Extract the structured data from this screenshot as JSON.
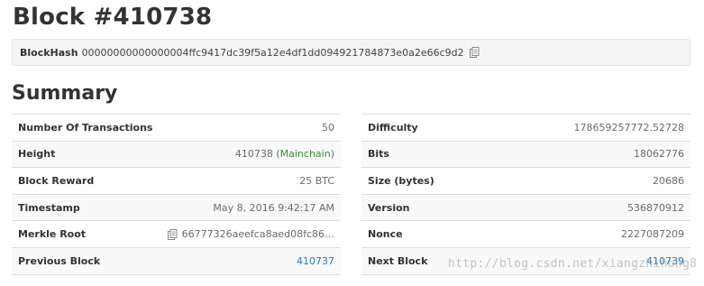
{
  "page": {
    "title": "Block #410738"
  },
  "hash": {
    "label": "BlockHash",
    "value": "00000000000000004ffc9417dc39f5a12e4df1dd094921784873e0a2e66c9d2",
    "copy_icon": "copy-icon"
  },
  "summary": {
    "title": "Summary",
    "left": {
      "transactions_label": "Number Of Transactions",
      "transactions_value": "50",
      "height_label": "Height",
      "height_value": "410738",
      "height_chain_prefix": " (",
      "height_chain": "Mainchain",
      "height_chain_suffix": ")",
      "reward_label": "Block Reward",
      "reward_value": "25 BTC",
      "timestamp_label": "Timestamp",
      "timestamp_value": "May 8, 2016 9:42:17 AM",
      "merkle_label": "Merkle Root",
      "merkle_value": "66777326aeefca8aed08fc86…",
      "previous_label": "Previous Block",
      "previous_value": "410737"
    },
    "right": {
      "difficulty_label": "Difficulty",
      "difficulty_value": "178659257772.52728",
      "bits_label": "Bits",
      "bits_value": "18062776",
      "size_label": "Size (bytes)",
      "size_value": "20686",
      "version_label": "Version",
      "version_value": "536870912",
      "nonce_label": "Nonce",
      "nonce_value": "2227087209",
      "next_label": "Next Block",
      "next_value": "410739"
    }
  },
  "watermark": "http://blog.csdn.net/xiangzhihong8",
  "colors": {
    "link": "#2a7ab8",
    "chain": "#3c8a3c",
    "muted": "#6b6b6b"
  }
}
